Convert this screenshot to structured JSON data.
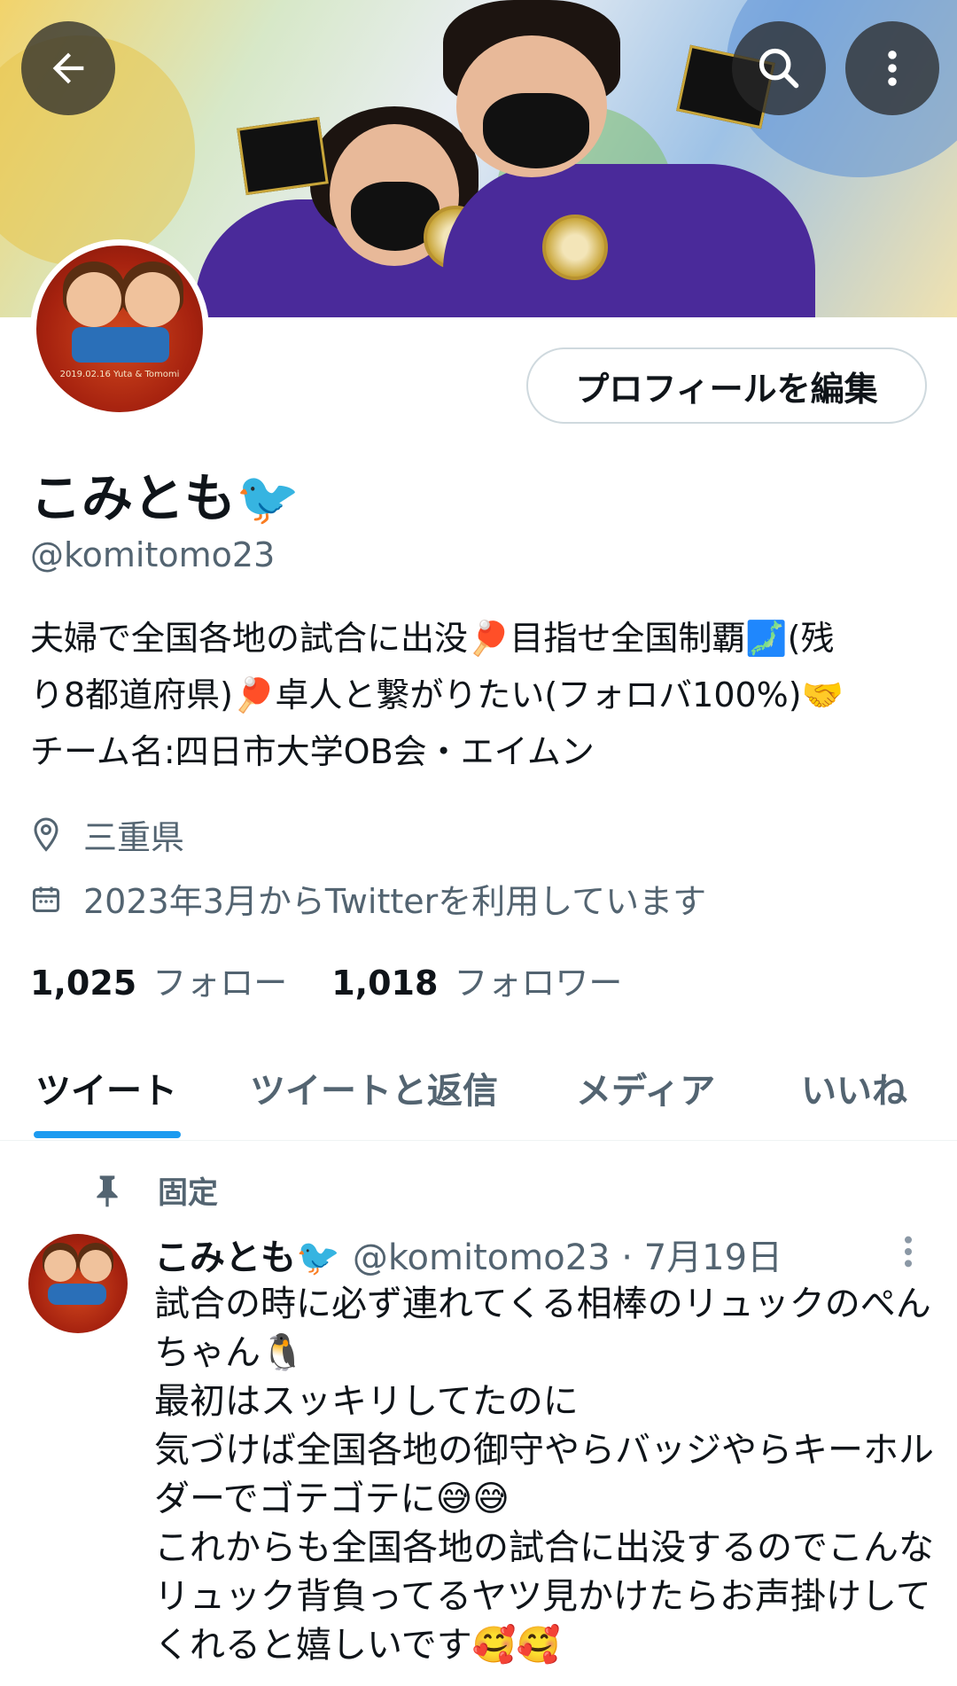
{
  "header": {
    "back_icon": "arrow-left-icon",
    "search_icon": "search-icon",
    "more_icon": "more-vertical-icon"
  },
  "profile": {
    "edit_button": "プロフィールを編集",
    "name": "こみとも🐦",
    "handle": "@komitomo23",
    "bio_lines": [
      "夫婦で全国各地の試合に出没🏓目指せ全国制覇🗾(残",
      "り8都道府県)🏓卓人と繋がりたい(フォロバ100%)🤝",
      "チーム名:四日市大学OB会・エイムン"
    ],
    "location": "三重県",
    "joined": "2023年3月からTwitterを利用しています",
    "following_count": "1,025",
    "following_label": "フォロー",
    "followers_count": "1,018",
    "followers_label": "フォロワー",
    "avatar_caption": "2019.02.16 Yuta & Tomomi"
  },
  "tabs": [
    "ツイート",
    "ツイートと返信",
    "メディア",
    "いいね"
  ],
  "pinned_tweet": {
    "pinned_label": "固定",
    "name": "こみとも🐦",
    "meta": "@komitomo23 · 7月19日",
    "body": "試合の時に必ず連れてくる相棒のリュックのぺんちゃん🐧\n最初はスッキリしてたのに\n気づけば全国各地の御守やらバッジやらキーホルダーでゴテゴテに😅😅\nこれからも全国各地の試合に出没するのでこんなリュック背負ってるヤツ見かけたらお声掛けしてくれると嬉しいです🥰🥰"
  },
  "colors": {
    "accent": "#1d9bf0",
    "text": "#0f1419",
    "secondary": "#536471",
    "shirt": "#4a2a9a"
  }
}
